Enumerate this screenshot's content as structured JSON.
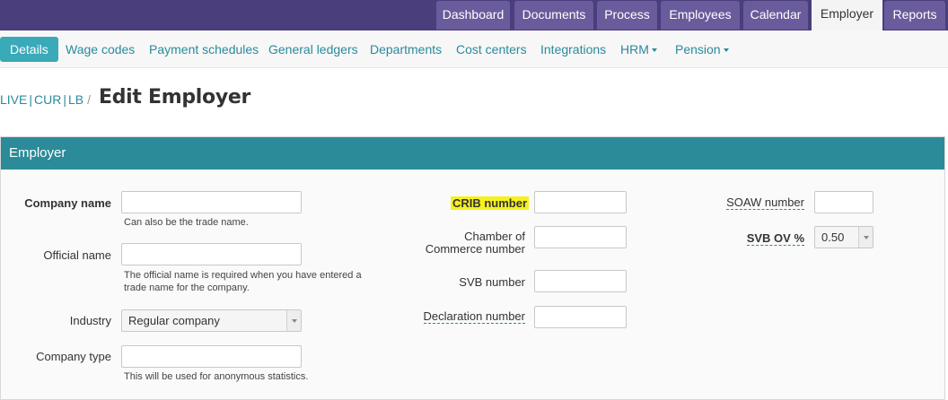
{
  "topnav": {
    "tabs": [
      {
        "label": "Dashboard"
      },
      {
        "label": "Documents"
      },
      {
        "label": "Process"
      },
      {
        "label": "Employees"
      },
      {
        "label": "Calendar"
      },
      {
        "label": "Employer"
      },
      {
        "label": "Reports"
      }
    ],
    "active": "Employer"
  },
  "subnav": {
    "items": [
      {
        "label": "Details"
      },
      {
        "label": "Wage codes"
      },
      {
        "label": "Payment schedules"
      },
      {
        "label": "General ledgers"
      },
      {
        "label": "Departments"
      },
      {
        "label": "Cost centers"
      },
      {
        "label": "Integrations"
      },
      {
        "label": "HRM"
      },
      {
        "label": "Pension"
      }
    ],
    "active": "Details"
  },
  "breadcrumb": {
    "parts": [
      "LIVE",
      "CUR",
      "LB"
    ],
    "separator": "/"
  },
  "page_title": "Edit Employer",
  "panel": {
    "title": "Employer"
  },
  "form": {
    "company_name": {
      "label": "Company name",
      "value": "",
      "help": "Can also be the trade name."
    },
    "official_name": {
      "label": "Official name",
      "value": "",
      "help_line1": "The official name is required when you have entered a",
      "help_line2": "trade name for the company."
    },
    "industry": {
      "label": "Industry",
      "value": "Regular company"
    },
    "company_type": {
      "label": "Company type",
      "value": "",
      "help": "This will be used for anonymous statistics."
    },
    "crib_number": {
      "label": "CRIB number",
      "value": ""
    },
    "chamber_of_commerce": {
      "label_line1": "Chamber of",
      "label_line2": "Commerce number",
      "value": ""
    },
    "svb_number": {
      "label": "SVB number",
      "value": ""
    },
    "declaration_number": {
      "label": "Declaration number",
      "value": ""
    },
    "soaw_number": {
      "label": "SOAW number",
      "value": ""
    },
    "svb_ov": {
      "label": "SVB OV %",
      "value": "0.50"
    }
  },
  "colors": {
    "topnav": "#4a3e7c",
    "accent": "#2b8b98",
    "highlight": "#f6f01e"
  }
}
